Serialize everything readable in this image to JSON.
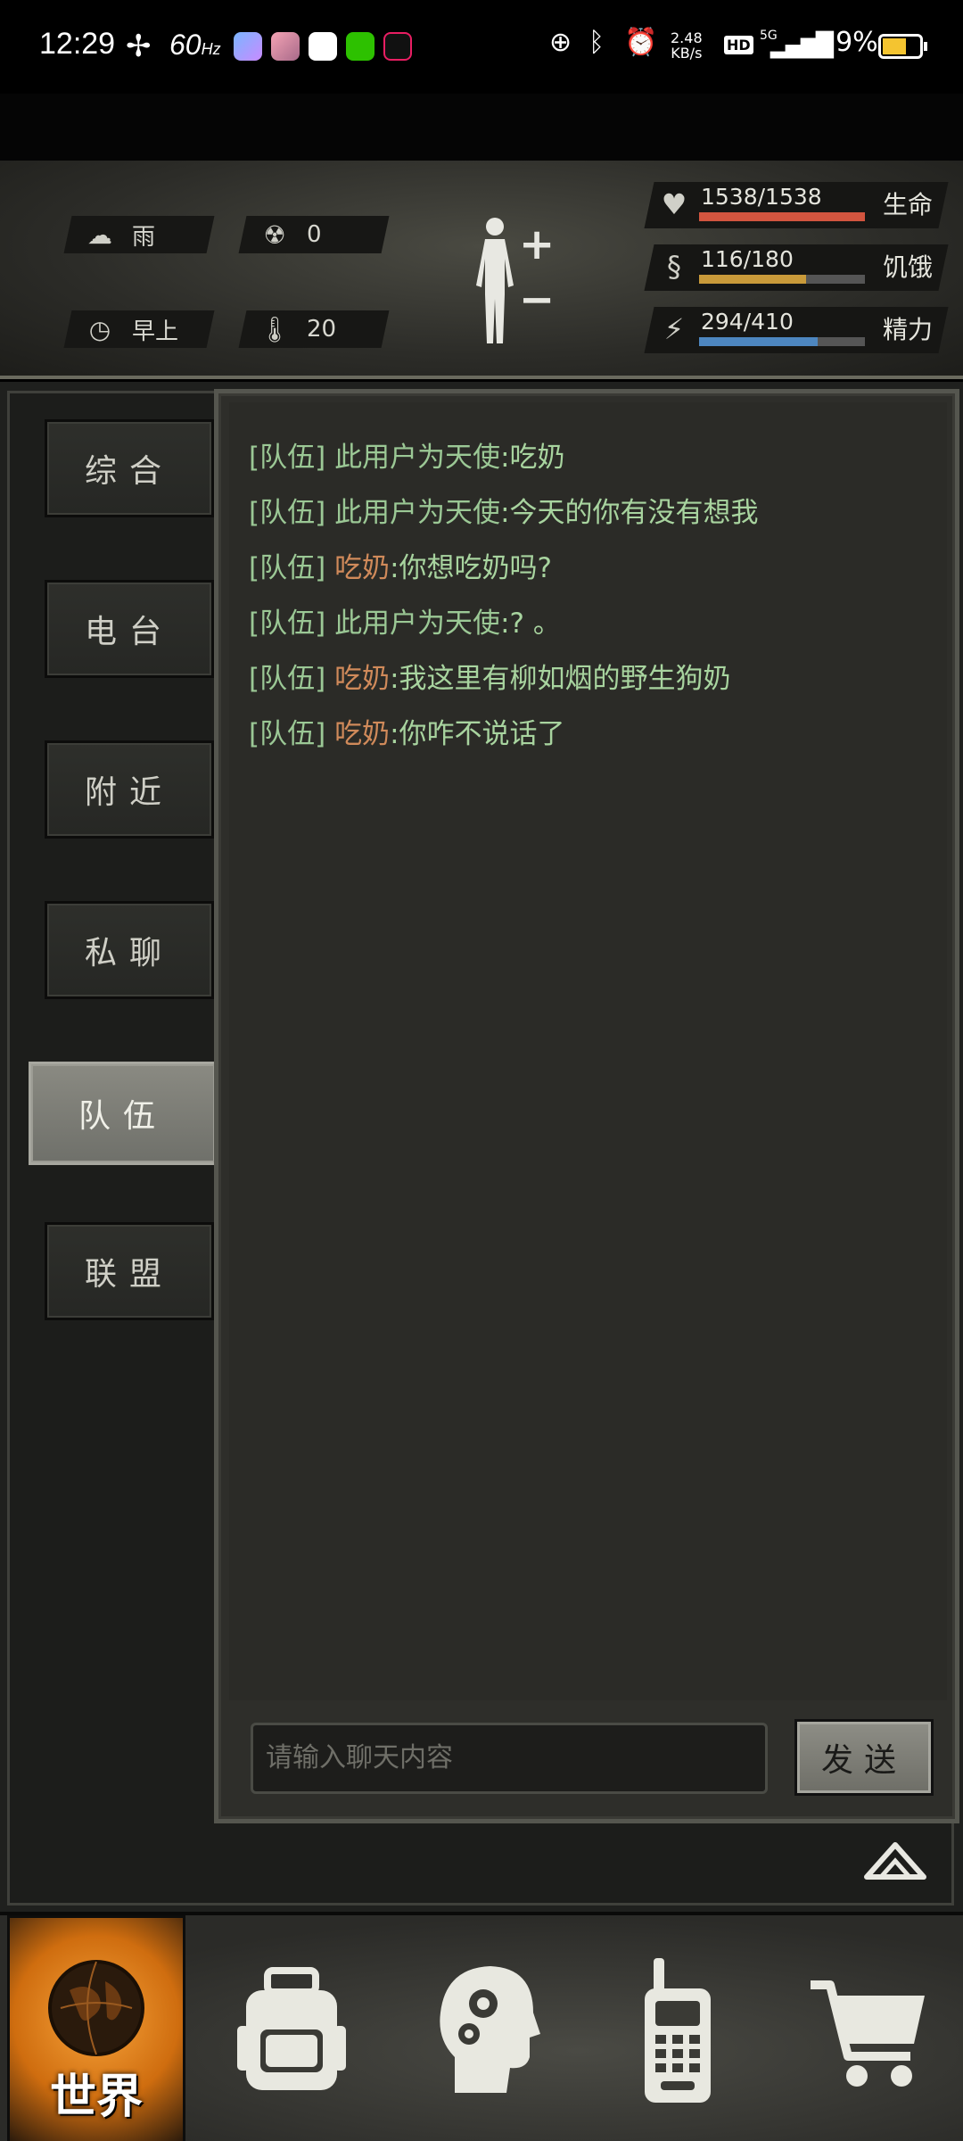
{
  "status_bar": {
    "time": "12:29",
    "refresh_rate": "60",
    "refresh_unit": "Hz",
    "net_speed": "2.48",
    "net_unit": "KB/s",
    "hd": "HD",
    "network": "5G",
    "battery": "59%"
  },
  "hud": {
    "weather": "雨",
    "radiation": "0",
    "time_of_day": "早上",
    "temperature": "20",
    "health": {
      "value": "1538/1538",
      "label": "生命",
      "fraction": 1.0,
      "color": "#d2553f"
    },
    "hunger": {
      "value": "116/180",
      "label": "饥饿",
      "fraction": 0.644,
      "color": "#c99a3a"
    },
    "energy": {
      "value": "294/410",
      "label": "精力",
      "fraction": 0.717,
      "color": "#4d86bf"
    }
  },
  "tabs": [
    {
      "label": "综合",
      "active": false
    },
    {
      "label": "电台",
      "active": false
    },
    {
      "label": "附近",
      "active": false
    },
    {
      "label": "私聊",
      "active": false
    },
    {
      "label": "队伍",
      "active": true
    },
    {
      "label": "联盟",
      "active": false
    }
  ],
  "messages": [
    {
      "channel": "[队伍]",
      "sender": "此用户为天使",
      "sep": ":",
      "text": "吃奶",
      "sender_color": "green"
    },
    {
      "channel": "[队伍]",
      "sender": "此用户为天使",
      "sep": ":",
      "text": "今天的你有没有想我",
      "sender_color": "green"
    },
    {
      "channel": "[队伍]",
      "sender": "吃奶",
      "sep": ":",
      "text": "你想吃奶吗?",
      "sender_color": "orange"
    },
    {
      "channel": "[队伍]",
      "sender": "此用户为天使",
      "sep": ":",
      "text": "? 。",
      "sender_color": "green"
    },
    {
      "channel": "[队伍]",
      "sender": "吃奶",
      "sep": ":",
      "text": "我这里有柳如烟的野生狗奶",
      "sender_color": "orange"
    },
    {
      "channel": "[队伍]",
      "sender": "吃奶",
      "sep": ":",
      "text": "你咋不说话了",
      "sender_color": "orange"
    }
  ],
  "chat_input": {
    "placeholder": "请输入聊天内容"
  },
  "send_button": "发送",
  "bottom_nav": {
    "world_label": "世界",
    "items": [
      "globe-icon",
      "backpack-icon",
      "brain-head-icon",
      "walkie-talkie-icon",
      "cart-icon"
    ]
  }
}
